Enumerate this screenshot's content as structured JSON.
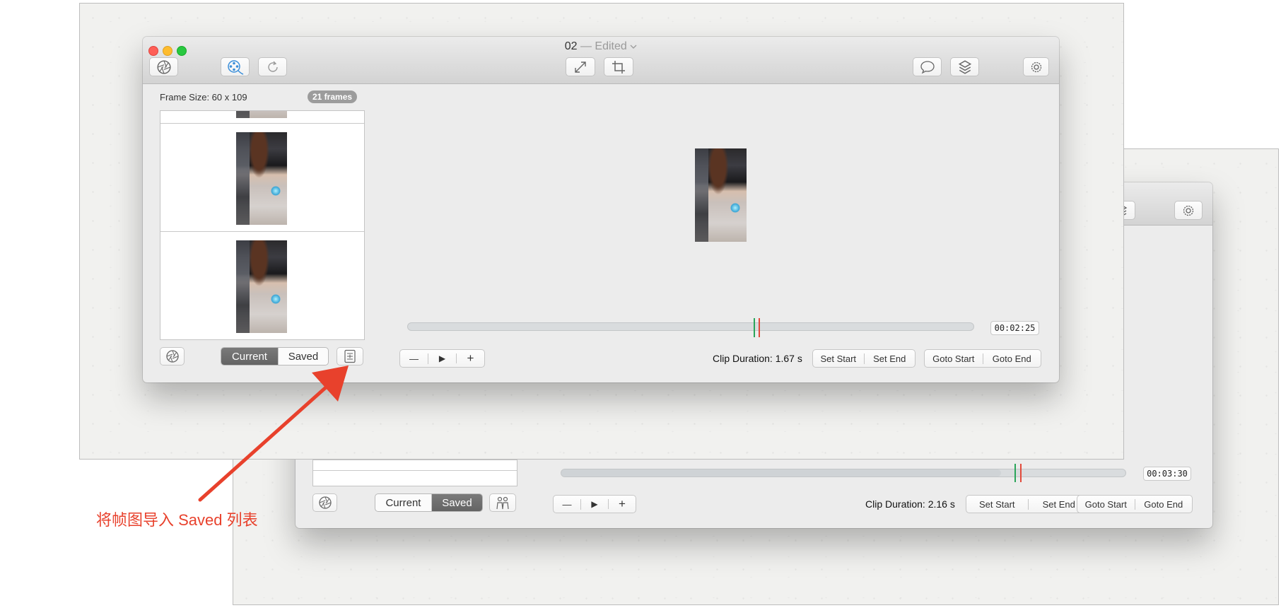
{
  "back_window": {
    "timecode": "00:03:30",
    "clip_duration": "Clip Duration: 2.16 s",
    "set_start": "Set Start",
    "set_end": "Set End",
    "goto_start": "Goto Start",
    "goto_end": "Goto End",
    "seg_current": "Current",
    "seg_saved": "Saved",
    "selected_segment": "Saved"
  },
  "front_window": {
    "title": "02",
    "title_suffix": " — Edited",
    "frame_size": "Frame Size: 60 x 109",
    "frames_badge": "21 frames",
    "timecode": "00:02:25",
    "clip_duration": "Clip Duration: 1.67 s",
    "set_start": "Set Start",
    "set_end": "Set End",
    "goto_start": "Goto Start",
    "goto_end": "Goto End",
    "seg_current": "Current",
    "seg_saved": "Saved",
    "selected_segment": "Current",
    "minus": "—",
    "play": "▶",
    "plus": "+"
  },
  "annotation": {
    "text": "将帧图导入 Saved 列表",
    "color": "#e8412c"
  },
  "colors": {
    "close": "#fe5f57",
    "minimize": "#febc2e",
    "zoom": "#28c840",
    "start_marker": "#2aa55a",
    "end_marker": "#e24a3b",
    "selected_segment": "#6e6e6e",
    "accent_blue": "#3b8fd9"
  },
  "icons": {
    "aperture": "aperture-icon",
    "film_reel": "film-reel-icon",
    "refresh": "refresh-icon",
    "resize": "resize-icon",
    "crop": "crop-icon",
    "comment": "speech-bubble-icon",
    "layers": "layers-icon",
    "settings": "gear-icon",
    "import_frames": "import-to-list-icon",
    "people": "people-icon"
  }
}
